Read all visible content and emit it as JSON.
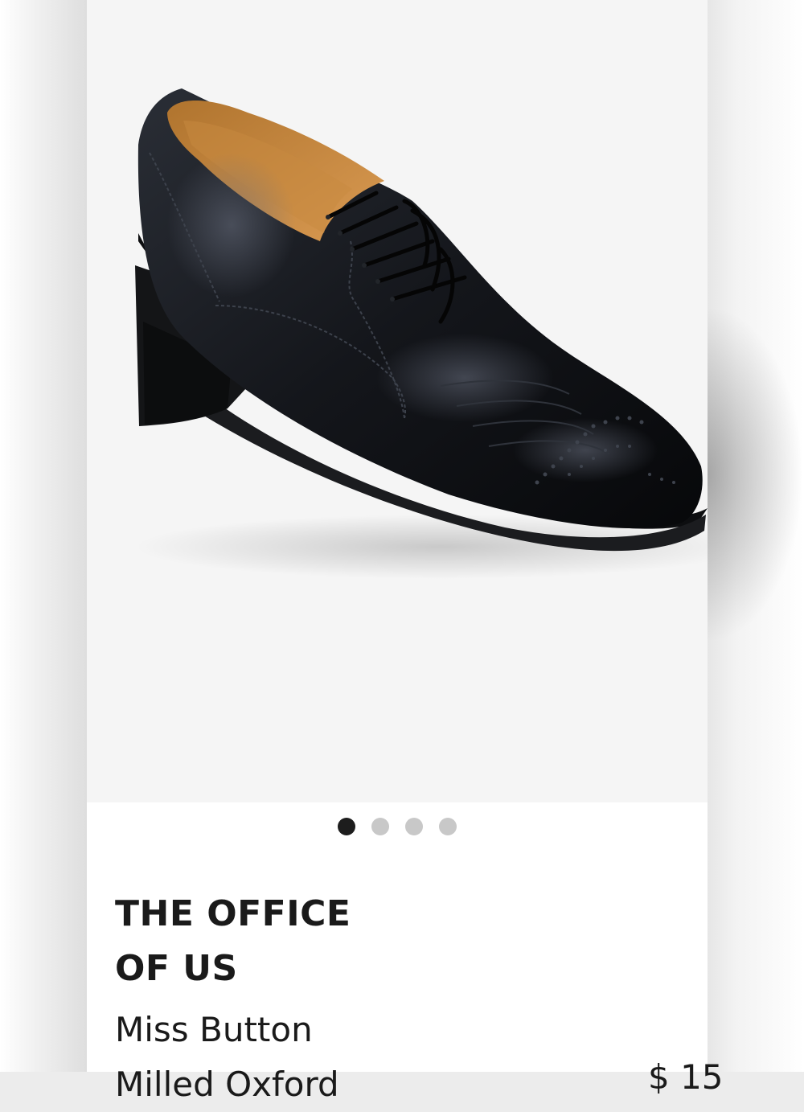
{
  "product": {
    "brand_line1": "THE OFFICE",
    "brand_line2": "OF US",
    "name_line1": "Miss Button",
    "name_line2": "Milled Oxford",
    "price": "$ 15",
    "image_alt": "Black leather block-heel oxford shoe with brogue toe cap"
  },
  "carousel": {
    "total": 4,
    "active_index": 0
  },
  "colors": {
    "active_dot": "#1d1d1d",
    "inactive_dot": "#c8c8c8",
    "text": "#1a1a1a",
    "image_bg": "#f5f5f5"
  }
}
